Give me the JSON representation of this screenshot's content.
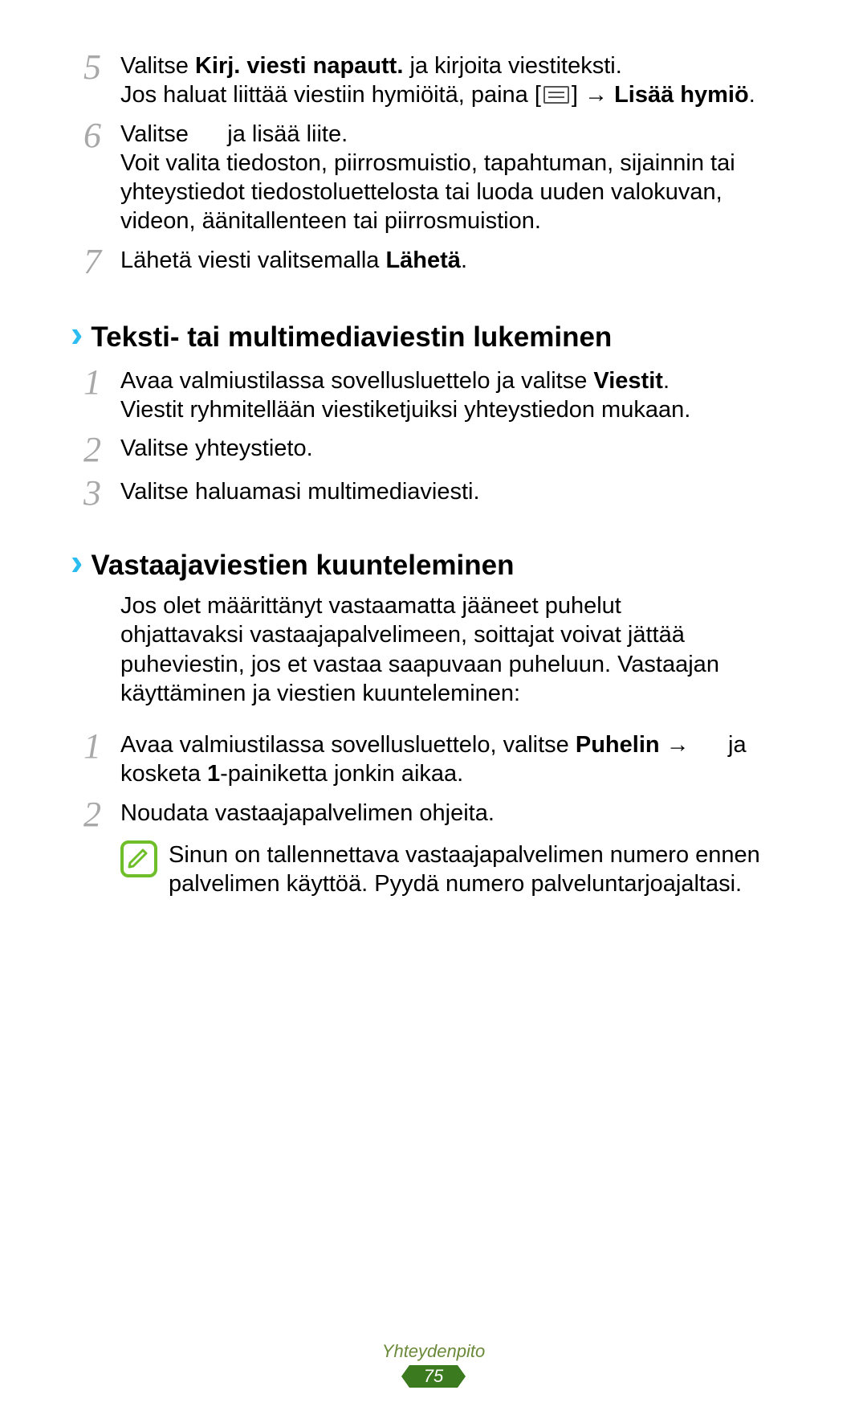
{
  "steps_top": [
    {
      "num": "5",
      "parts": {
        "p1a": "Valitse ",
        "p1b": "Kirj. viesti napautt.",
        "p1c": " ja kirjoita viestiteksti.",
        "p2a": "Jos haluat liittää viestiin hymiöitä, paina [",
        "p2b": "] → ",
        "p2c": "Lisää hymiö",
        "p2d": "."
      }
    },
    {
      "num": "6",
      "parts": {
        "p1a": "Valitse ",
        "p1b": " ja lisää liite.",
        "p2": "Voit valita tiedoston, piirrosmuistio, tapahtuman, sijainnin tai yhteystiedot tiedostoluettelosta tai luoda uuden valokuvan, videon, äänitallenteen tai piirrosmuistion."
      }
    },
    {
      "num": "7",
      "parts": {
        "p1a": "Lähetä viesti valitsemalla ",
        "p1b": "Lähetä",
        "p1c": "."
      }
    }
  ],
  "section1": {
    "title": "Teksti- tai multimediaviestin lukeminen",
    "steps": [
      {
        "num": "1",
        "parts": {
          "p1a": "Avaa valmiustilassa sovellusluettelo ja valitse ",
          "p1b": "Viestit",
          "p1c": ".",
          "p2": "Viestit ryhmitellään viestiketjuiksi yhteystiedon mukaan."
        }
      },
      {
        "num": "2",
        "text": "Valitse yhteystieto."
      },
      {
        "num": "3",
        "text": "Valitse haluamasi multimediaviesti."
      }
    ]
  },
  "section2": {
    "title": "Vastaajaviestien kuunteleminen",
    "intro": "Jos olet määrittänyt vastaamatta jääneet puhelut ohjattavaksi vastaajapalvelimeen, soittajat voivat jättää puheviestin, jos et vastaa saapuvaan puheluun. Vastaajan käyttäminen ja viestien kuunteleminen:",
    "steps": [
      {
        "num": "1",
        "parts": {
          "p1a": "Avaa valmiustilassa sovellusluettelo, valitse ",
          "p1b": "Puhelin",
          "p1c": " → ",
          "p1d": " ja kosketa ",
          "p1e": "1",
          "p1f": "-painiketta jonkin aikaa."
        }
      },
      {
        "num": "2",
        "text": "Noudata vastaajapalvelimen ohjeita."
      }
    ],
    "note": "Sinun on tallennettava vastaajapalvelimen numero ennen palvelimen käyttöä. Pyydä numero palveluntarjoajaltasi."
  },
  "footer": {
    "label": "Yhteydenpito",
    "page": "75"
  }
}
